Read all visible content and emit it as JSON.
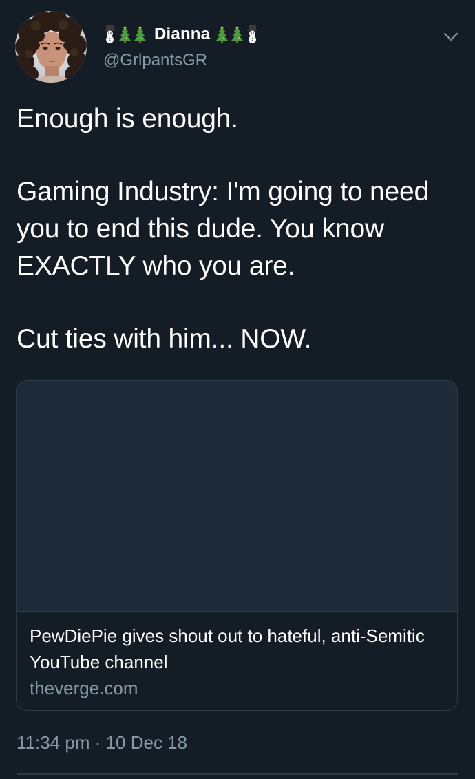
{
  "tweet": {
    "author": {
      "display_name": "Dianna",
      "handle": "@GrlpantsGR",
      "name_prefix_emojis": [
        "snowman-icon",
        "christmas-tree-icon",
        "christmas-tree-icon"
      ],
      "name_suffix_emojis": [
        "christmas-tree-icon",
        "christmas-tree-icon",
        "snowman-icon"
      ]
    },
    "text": {
      "line1": "Enough is enough.",
      "line2": "Gaming Industry: I'm going to need you to end this dude. You know EXACTLY who you are.",
      "line3": "Cut ties with him... NOW."
    },
    "card": {
      "title": "PewDiePie gives shout out to hateful, anti-Semitic YouTube channel",
      "domain": "theverge.com"
    },
    "timestamp": "11:34 pm · 10 Dec 18"
  },
  "colors": {
    "background": "#141d26",
    "text_primary": "#ffffff",
    "text_secondary": "#8899a6",
    "border": "#2c3a48",
    "card_image_placeholder": "#1f2a38"
  }
}
